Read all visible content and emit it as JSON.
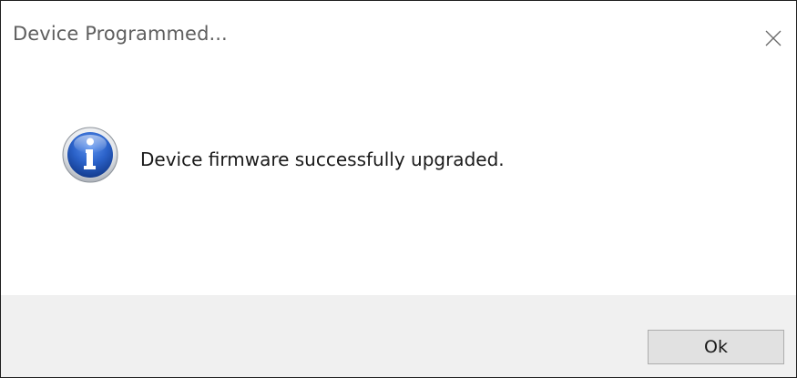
{
  "window": {
    "title": "Device Programmed..."
  },
  "message": {
    "text": "Device firmware successfully upgraded.",
    "icon": "info-icon"
  },
  "footer": {
    "ok_label": "Ok"
  },
  "colors": {
    "icon_blue": "#1f4fb0",
    "footer_bg": "#f0f0f0",
    "button_bg": "#e1e1e1",
    "button_border": "#adadad"
  }
}
